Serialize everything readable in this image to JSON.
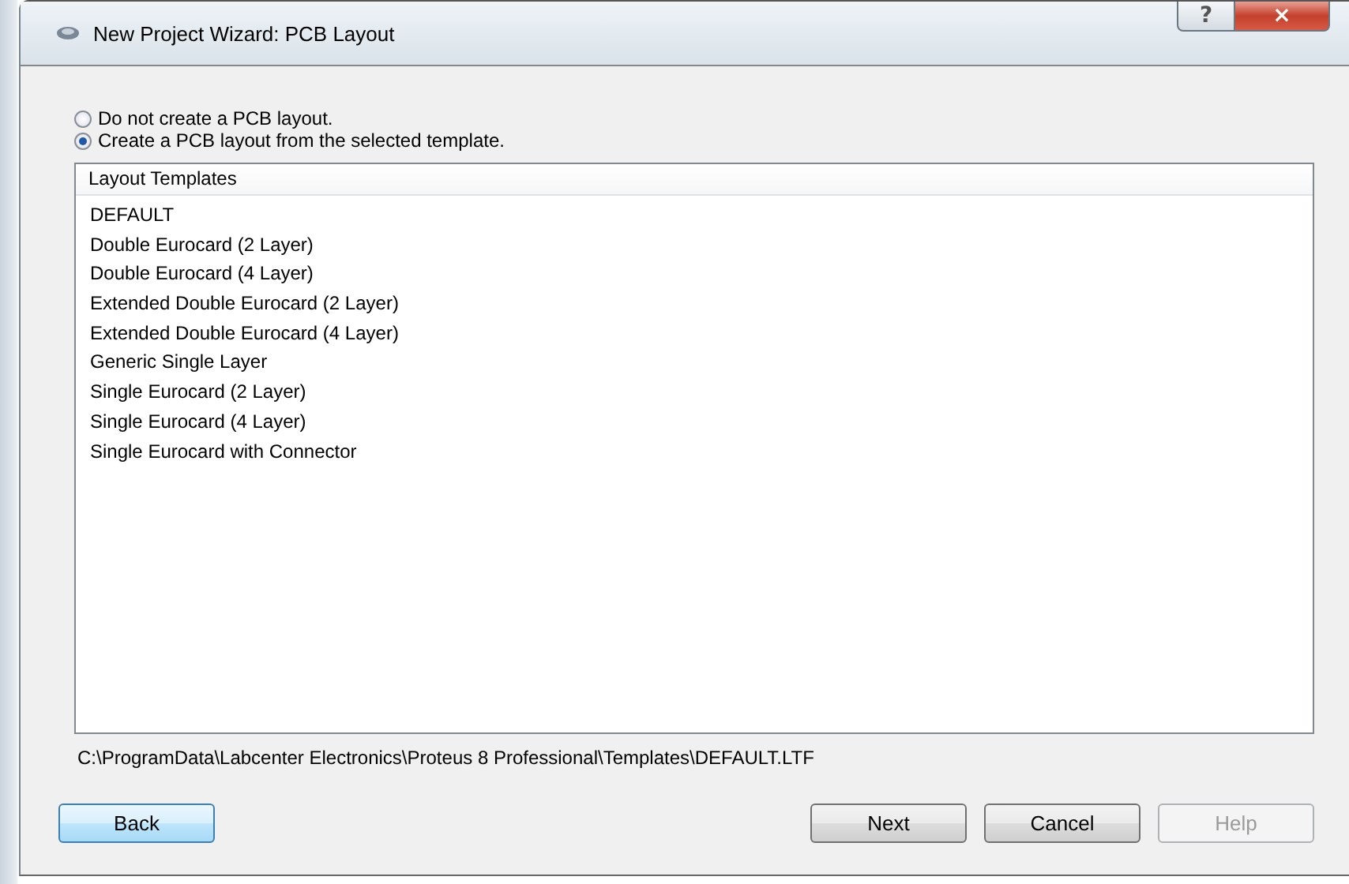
{
  "window": {
    "title": "New Project Wizard: PCB Layout",
    "help_button": "?",
    "close_button": "×"
  },
  "options": [
    {
      "label": "Do not create a PCB layout.",
      "selected": false
    },
    {
      "label": "Create a PCB layout from the selected template.",
      "selected": true
    }
  ],
  "templates": {
    "header": "Layout Templates",
    "items": [
      {
        "label": "DEFAULT",
        "selected": false
      },
      {
        "label": "Double Eurocard (2 Layer)",
        "selected": false
      },
      {
        "label": "Double Eurocard (4 Layer)",
        "selected": false
      },
      {
        "label": "Extended Double Eurocard (2 Layer)",
        "selected": false
      },
      {
        "label": "Extended Double Eurocard (4 Layer)",
        "selected": false
      },
      {
        "label": "Generic Single Layer",
        "selected": false
      },
      {
        "label": "Single Eurocard (2 Layer)",
        "selected": false
      },
      {
        "label": "Single Eurocard (4 Layer)",
        "selected": false
      },
      {
        "label": "Single Eurocard with Connector",
        "selected": false
      }
    ]
  },
  "path": "C:\\ProgramData\\Labcenter Electronics\\Proteus 8 Professional\\Templates\\DEFAULT.LTF",
  "buttons": [
    {
      "label": "Back",
      "kind": "focused",
      "disabled": false
    },
    {
      "label": "Next",
      "kind": "normal",
      "disabled": false
    },
    {
      "label": "Cancel",
      "kind": "normal",
      "disabled": false
    },
    {
      "label": "Help",
      "kind": "normal",
      "disabled": true
    }
  ]
}
